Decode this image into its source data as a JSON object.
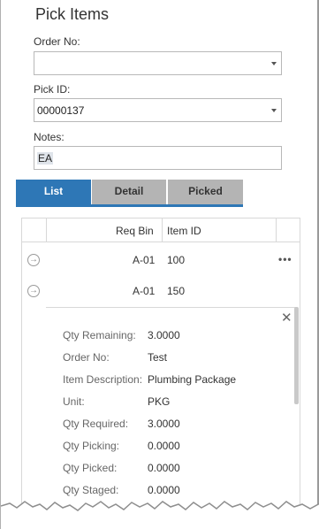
{
  "page": {
    "title": "Pick Items"
  },
  "form": {
    "order_no": {
      "label": "Order No:",
      "value": ""
    },
    "pick_id": {
      "label": "Pick ID:",
      "value": "00000137"
    },
    "notes": {
      "label": "Notes:",
      "value": "EA"
    }
  },
  "tabs": [
    {
      "label": "List",
      "active": true
    },
    {
      "label": "Detail",
      "active": false
    },
    {
      "label": "Picked",
      "active": false
    }
  ],
  "grid": {
    "columns": [
      "Req Bin",
      "Item ID"
    ],
    "rows": [
      {
        "req_bin": "A-01",
        "item_id": "100"
      },
      {
        "req_bin": "A-01",
        "item_id": "150"
      }
    ],
    "more_label": "•••"
  },
  "detail": {
    "close_label": "✕",
    "fields": [
      {
        "label": "Qty Remaining:",
        "value": "3.0000"
      },
      {
        "label": "Order No:",
        "value": "Test"
      },
      {
        "label": "Item Description:",
        "value": "Plumbing Package"
      },
      {
        "label": "Unit:",
        "value": "PKG"
      },
      {
        "label": "Qty Required:",
        "value": "3.0000"
      },
      {
        "label": "Qty Picking:",
        "value": "0.0000"
      },
      {
        "label": "Qty Picked:",
        "value": "0.0000"
      },
      {
        "label": "Qty Staged:",
        "value": "0.0000"
      }
    ]
  },
  "colors": {
    "accent": "#2e77b6",
    "tab_inactive": "#b4b4b4"
  },
  "icons": {
    "dropdown": "caret-down-icon",
    "row_nav": "circle-arrow-right-icon",
    "close": "close-icon",
    "more": "ellipsis-icon"
  }
}
